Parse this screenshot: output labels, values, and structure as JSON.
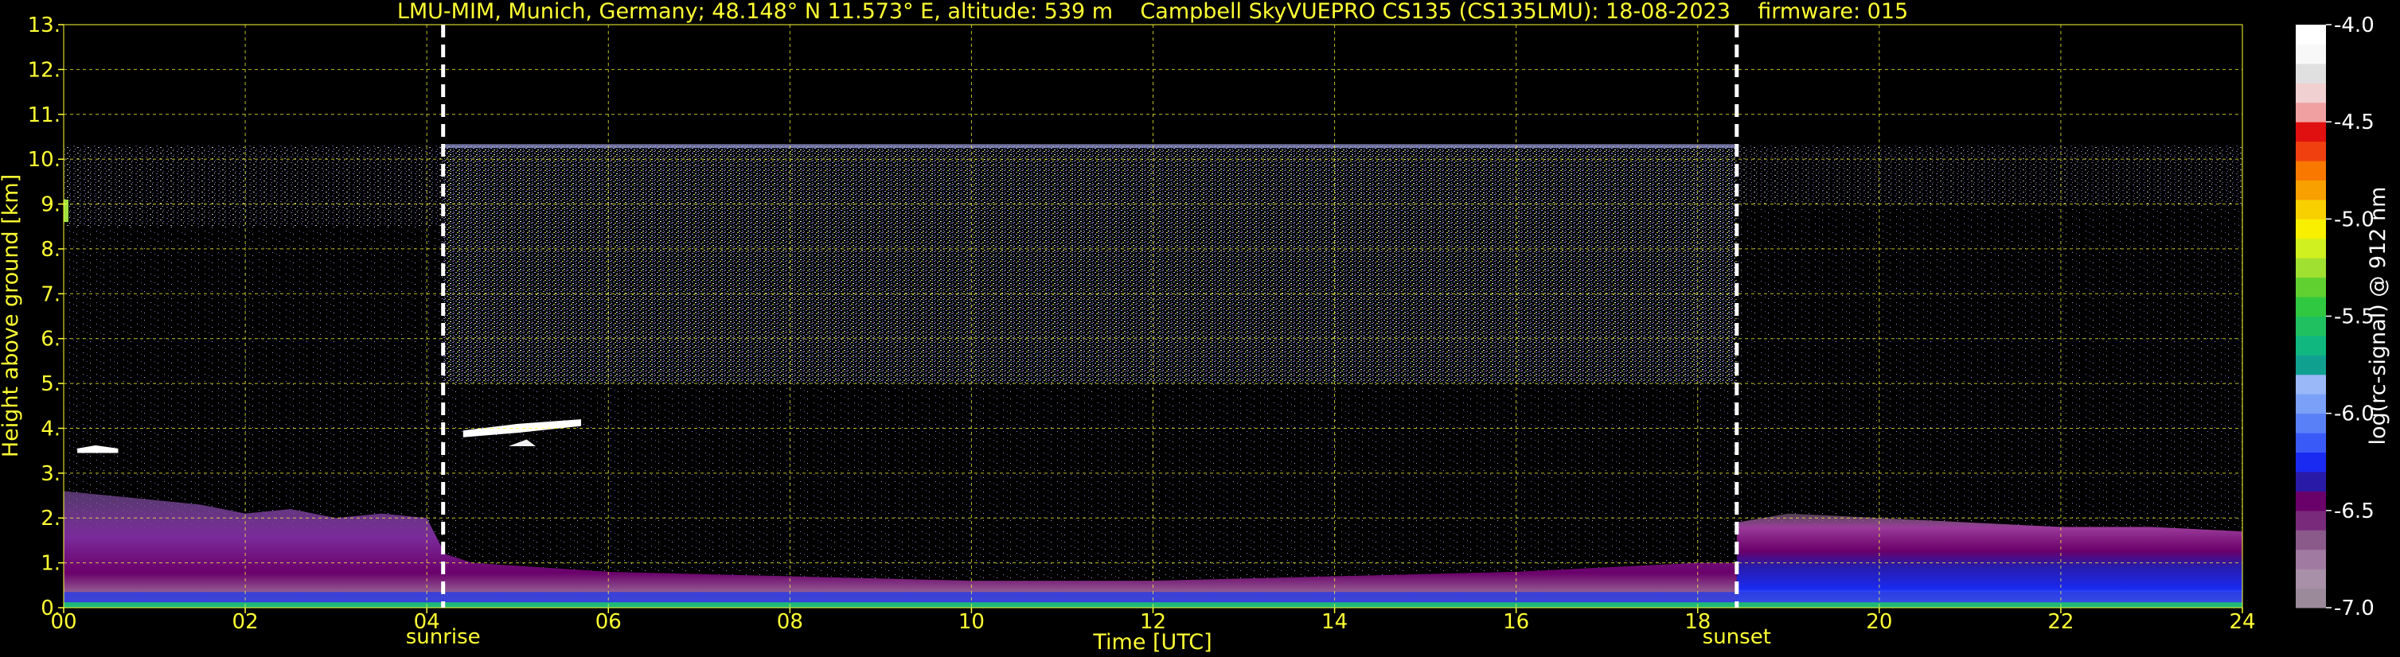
{
  "chart_data": {
    "type": "heatmap",
    "title": "LMU-MIM, Munich, Germany; 48.148° N 11.573° E, altitude: 539 m    Campbell SkyVUEPRO CS135 (CS135LMU): 18-08-2023    firmware: 015",
    "xlabel": "Time [UTC]",
    "ylabel": "Height above ground [km]",
    "xlim": [
      0,
      24
    ],
    "ylim": [
      0,
      13
    ],
    "x_ticks": [
      "00",
      "02",
      "04",
      "06",
      "08",
      "10",
      "12",
      "14",
      "16",
      "18",
      "20",
      "22",
      "24"
    ],
    "y_ticks": [
      "0.",
      "1.",
      "2.",
      "3.",
      "4.",
      "5.",
      "6.",
      "7.",
      "8.",
      "9.",
      "10.",
      "11.",
      "12.",
      "13."
    ],
    "grid": true,
    "colorbar": {
      "label": "log(rc-signal) @ 912 nm",
      "range": [
        -7.0,
        -4.0
      ],
      "ticks": [
        "-4.0",
        "-4.5",
        "-5.0",
        "-5.5",
        "-6.0",
        "-6.5",
        "-7.0"
      ],
      "colors": [
        "#9a8a9a",
        "#a890a8",
        "#a07aa0",
        "#8a5a8a",
        "#7a2a7a",
        "#6a006a",
        "#2a1aa8",
        "#1a2af0",
        "#3a5af8",
        "#5a80f8",
        "#7aa0f8",
        "#9ab8f8",
        "#10a090",
        "#10b880",
        "#20c060",
        "#30c840",
        "#60d030",
        "#a0e030",
        "#d0f020",
        "#f8f000",
        "#f8d000",
        "#f8a000",
        "#f87800",
        "#f04010",
        "#e01010",
        "#f0a0a0",
        "#f0d0d0",
        "#e0e0e0",
        "#f8f8f8",
        "#ffffff"
      ]
    },
    "events": [
      {
        "name": "sunrise",
        "time": 4.18
      },
      {
        "name": "sunset",
        "time": 18.43
      }
    ],
    "features": [
      {
        "name": "boundary layer",
        "t_start": 0,
        "t_end": 24,
        "height_top": [
          2.5,
          1.0,
          1.7
        ]
      },
      {
        "name": "cloud",
        "t_start": 0.2,
        "t_end": 0.6,
        "height": 3.5
      },
      {
        "name": "cloud",
        "t_start": 4.4,
        "t_end": 5.7,
        "height": 4.0
      },
      {
        "name": "signal noise top",
        "height": 10.3
      }
    ]
  }
}
